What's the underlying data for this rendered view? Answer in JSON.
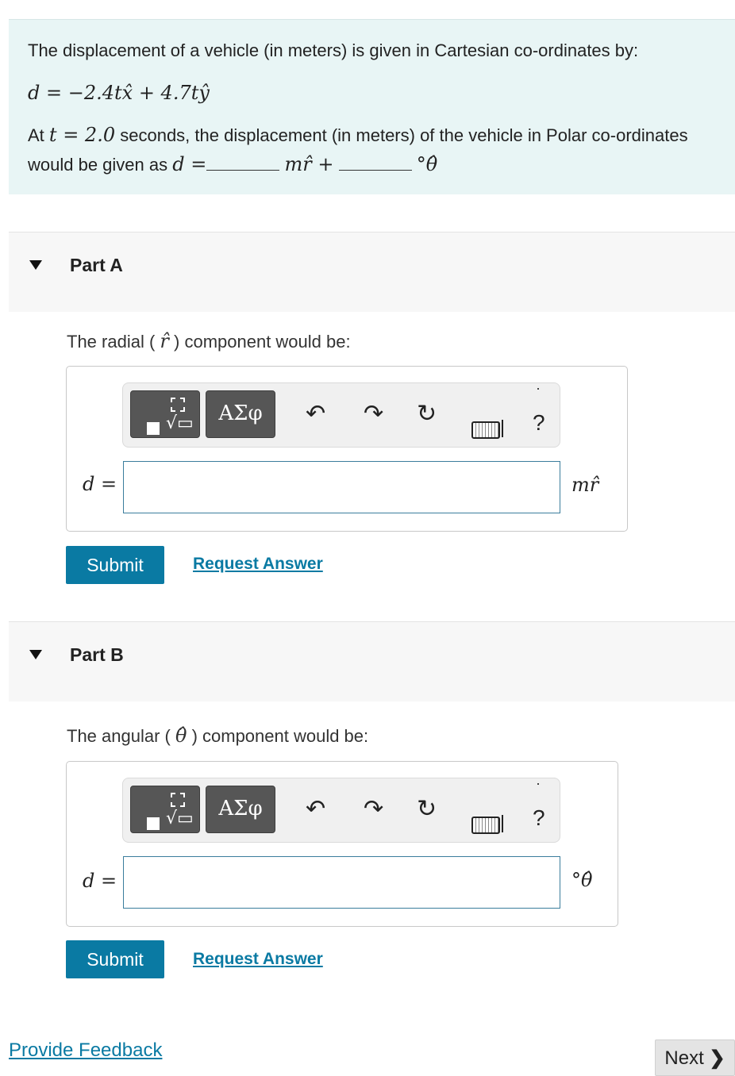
{
  "intro": {
    "line1": "The displacement of a vehicle (in meters) is given in Cartesian co-ordinates by:",
    "equation": "d = −2.4tx̂ + 4.7tŷ",
    "line3_prefix": "At",
    "line3_math": "t = 2.0",
    "line3_suffix": "seconds, the displacement (in meters) of the vehicle in Polar co-ordinates",
    "line4_prefix": "would be given as",
    "line4_math_d": "d =",
    "line4_mid": "mr̂ +",
    "line4_end": "°θ̂"
  },
  "partA": {
    "title": "Part A",
    "prompt_prefix": "The radial (",
    "prompt_symbol": "r̂",
    "prompt_suffix": ") component would be:",
    "d_label": "d =",
    "input_value": "",
    "unit": "mr̂",
    "submit_label": "Submit",
    "request_label": "Request Answer"
  },
  "partB": {
    "title": "Part B",
    "prompt_prefix": "The angular (",
    "prompt_symbol": "θ̂",
    "prompt_suffix": ") component would be:",
    "d_label": "d =",
    "input_value": "",
    "unit": "°θ̂",
    "submit_label": "Submit",
    "request_label": "Request Answer"
  },
  "toolbar": {
    "greek_label": "ΑΣφ",
    "undo_icon": "↶",
    "redo_icon": "↷",
    "reset_icon": "↻",
    "help_label": "?"
  },
  "footer": {
    "feedback_label": "Provide Feedback",
    "next_label": "Next",
    "next_chevron": "❯"
  }
}
